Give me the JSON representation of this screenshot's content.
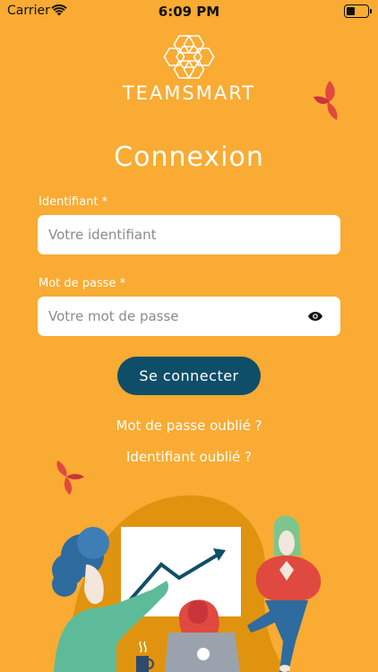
{
  "status_bar": {
    "carrier": "Carrier",
    "time": "6:09 PM"
  },
  "brand": {
    "name": "TEAMSMART"
  },
  "login": {
    "title": "Connexion",
    "username_label": "Identifiant *",
    "username_placeholder": "Votre identifiant",
    "password_label": "Mot de passe *",
    "password_placeholder": "Votre mot de passe",
    "submit_label": "Se connecter",
    "forgot_password": "Mot de passe oublié ?",
    "forgot_username": "Identifiant oublié ?"
  },
  "colors": {
    "background": "#F9AB33",
    "button": "#0F4E69",
    "accent": "#E0493F"
  }
}
